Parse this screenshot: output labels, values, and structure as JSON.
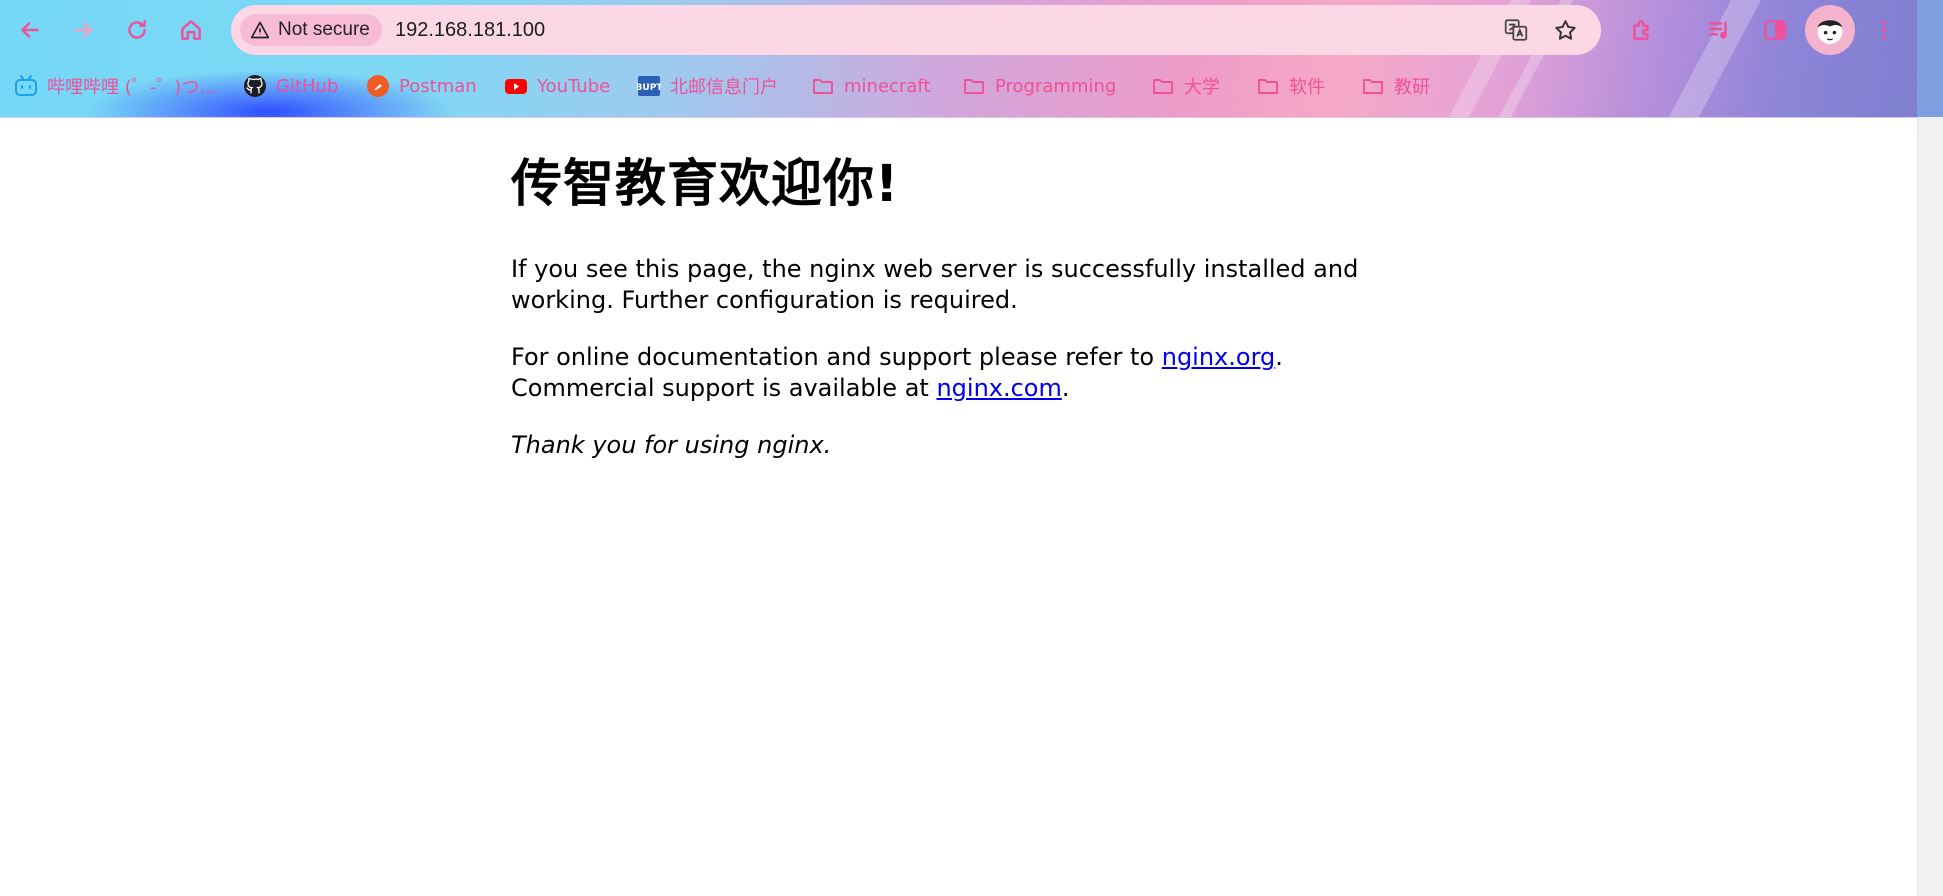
{
  "browser": {
    "security_label": "Not secure",
    "url": "192.168.181.100"
  },
  "bookmarks": [
    {
      "label": "哔哩哔哩 (゜-゜)つ...",
      "icon": "bilibili-icon"
    },
    {
      "label": "GitHub",
      "icon": "github-icon"
    },
    {
      "label": "Postman",
      "icon": "postman-icon"
    },
    {
      "label": "YouTube",
      "icon": "youtube-icon"
    },
    {
      "label": "北邮信息门户",
      "icon": "bupt-icon"
    },
    {
      "label": "minecraft",
      "icon": "folder-icon"
    },
    {
      "label": "Programming",
      "icon": "folder-icon"
    },
    {
      "label": "大学",
      "icon": "folder-icon"
    },
    {
      "label": "软件",
      "icon": "folder-icon"
    },
    {
      "label": "教研",
      "icon": "folder-icon"
    }
  ],
  "page": {
    "heading": "传智教育欢迎你!",
    "p1": "If you see this page, the nginx web server is successfully installed and working. Further configuration is required.",
    "p2_before": "For online documentation and support please refer to ",
    "p2_link1": "nginx.org",
    "p2_middle": ".",
    "p2_line2": "Commercial support is available at ",
    "p2_link2": "nginx.com",
    "p2_end": ".",
    "p3": "Thank you for using nginx."
  },
  "colors": {
    "accent_pink": "#f0509a",
    "link": "#0000ee",
    "omnibox": "#fcd7e6"
  }
}
